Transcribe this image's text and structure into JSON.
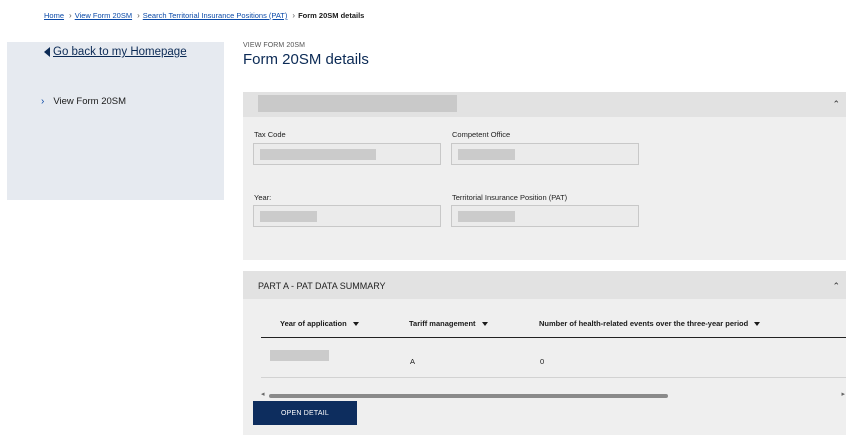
{
  "breadcrumb": {
    "items": [
      "Home",
      "View Form 20SM",
      "Search Territorial Insurance Positions (PAT)"
    ],
    "current": "Form 20SM details",
    "separator": "›"
  },
  "sidebar": {
    "back_link": "Go back to my Homepage",
    "items": [
      {
        "label": "View Form 20SM"
      }
    ],
    "chevron": "›"
  },
  "header": {
    "pre_title": "VIEW FORM 20SM",
    "title": "Form 20SM details"
  },
  "panel_details": {
    "fields": {
      "tax_code": {
        "label": "Tax Code",
        "value": ""
      },
      "competent_office": {
        "label": "Competent Office",
        "value": ""
      },
      "year": {
        "label": "Year:",
        "value": ""
      },
      "pat": {
        "label": "Territorial Insurance Position (PAT)",
        "value": ""
      }
    }
  },
  "panel_summary": {
    "title": "PART A - PAT DATA SUMMARY",
    "columns": [
      "Year of application",
      "Tariff management",
      "Number of health-related events over the three-year period"
    ],
    "rows": [
      {
        "year": "",
        "tariff": "A",
        "events": "0"
      }
    ],
    "open_button": "OPEN DETAIL",
    "scrollbar": {
      "position": 0
    }
  },
  "icons": {
    "collapse": "chevron-up-icon",
    "back": "triangle-left-icon",
    "sort": "caret-down-icon"
  },
  "colors": {
    "brand_dark": "#0d2d5e",
    "link": "#0b4aa8",
    "sidebar_bg": "#e6eaf0",
    "panel_bg": "#efefef",
    "panel_header_bg": "#e2e2e2"
  }
}
